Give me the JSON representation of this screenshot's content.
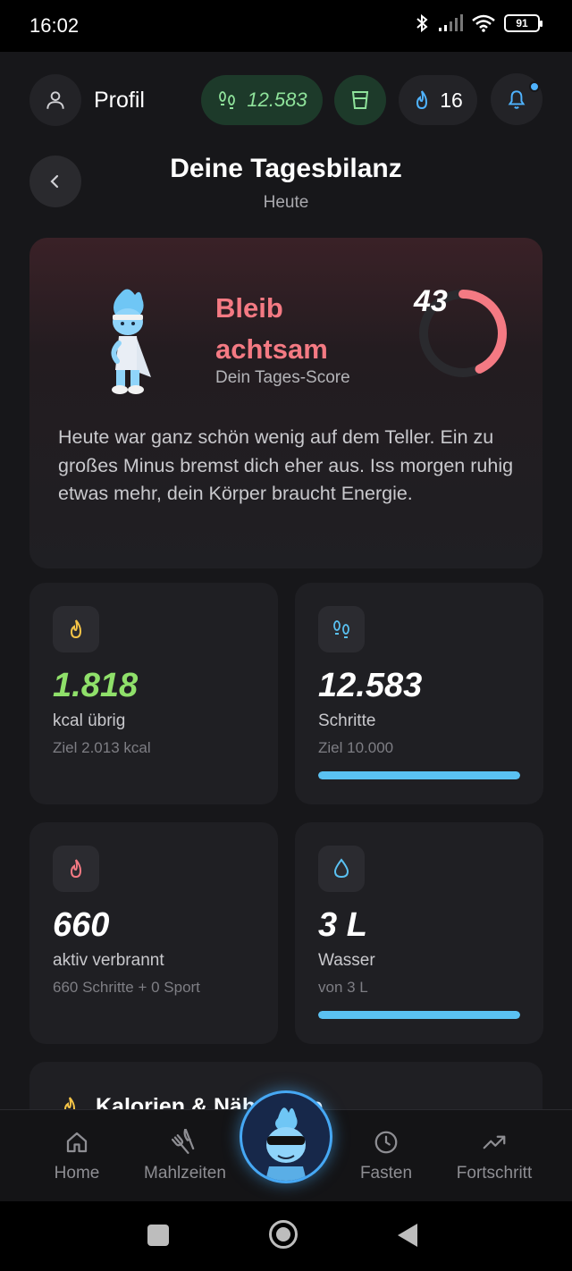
{
  "status_bar": {
    "time": "16:02",
    "battery": "91"
  },
  "top_bar": {
    "profile_label": "Profil",
    "steps_value": "12.583",
    "streak_value": "16"
  },
  "header": {
    "title": "Deine Tagesbilanz",
    "subtitle": "Heute"
  },
  "score_card": {
    "headline": "Bleib achtsam",
    "caption": "Dein Tages-Score",
    "score": "43",
    "score_fraction": 0.43,
    "message": "Heute war ganz schön wenig auf dem Teller. Ein zu großes Minus bremst dich eher aus. Iss morgen ruhig etwas mehr, dein Körper braucht Energie."
  },
  "stats": {
    "calories": {
      "value": "1.818",
      "label": "kcal übrig",
      "goal": "Ziel 2.013 kcal",
      "accent": "#f5c447",
      "value_color": "#8fe06a"
    },
    "steps": {
      "value": "12.583",
      "label": "Schritte",
      "goal": "Ziel 10.000",
      "progress": 1.0,
      "accent": "#5ac1f2"
    },
    "active": {
      "value": "660",
      "label": "aktiv verbrannt",
      "goal": "660 Schritte + 0 Sport",
      "accent": "#f47a83"
    },
    "water": {
      "value": "3 L",
      "label": "Wasser",
      "goal": "von 3 L",
      "progress": 1.0,
      "accent": "#5ac1f2"
    }
  },
  "next_section": {
    "label": "Kalorien & Nährwerte"
  },
  "bottom_nav": {
    "home": "Home",
    "meals": "Mahlzeiten",
    "fasting": "Fasten",
    "progress": "Fortschritt"
  },
  "colors": {
    "accent_green": "#8fe39b",
    "accent_blue": "#4fb3ff",
    "accent_red": "#f47a83"
  }
}
